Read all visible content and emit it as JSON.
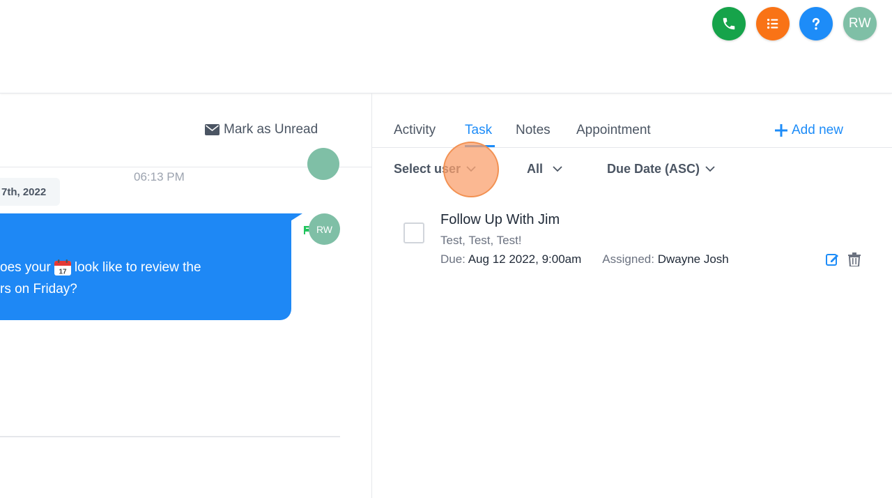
{
  "header": {
    "avatar_initials": "RW",
    "icons": [
      "phone-icon",
      "list-icon",
      "help-icon"
    ],
    "colors": {
      "phone": "#16a34a",
      "list": "#f97316",
      "help": "#1d8cf8",
      "avatar": "#7fbfa6"
    }
  },
  "conversation": {
    "mark_unread_label": "Mark as Unread",
    "time": "06:13 PM",
    "date_chip": "7th, 2022",
    "message_avatar_initials": "RW",
    "message_line1_prefix": "oes your",
    "message_line1_suffix": "look like to review the",
    "message_line2": "rs on Friday?",
    "bubble_color": "#1e88f5"
  },
  "panel": {
    "tabs": [
      {
        "label": "Activity"
      },
      {
        "label": "Task"
      },
      {
        "label": "Notes"
      },
      {
        "label": "Appointment"
      }
    ],
    "active_tab": "Task",
    "add_new_label": "Add new",
    "filters": {
      "user": "Select user",
      "status": "All",
      "sort": "Due Date (ASC)"
    }
  },
  "task": {
    "title": "Follow Up With Jim",
    "description": "Test, Test, Test!",
    "due_label": "Due:",
    "due_value": "Aug 12 2022, 9:00am",
    "assigned_label": "Assigned:",
    "assigned_value": "Dwayne Josh"
  }
}
